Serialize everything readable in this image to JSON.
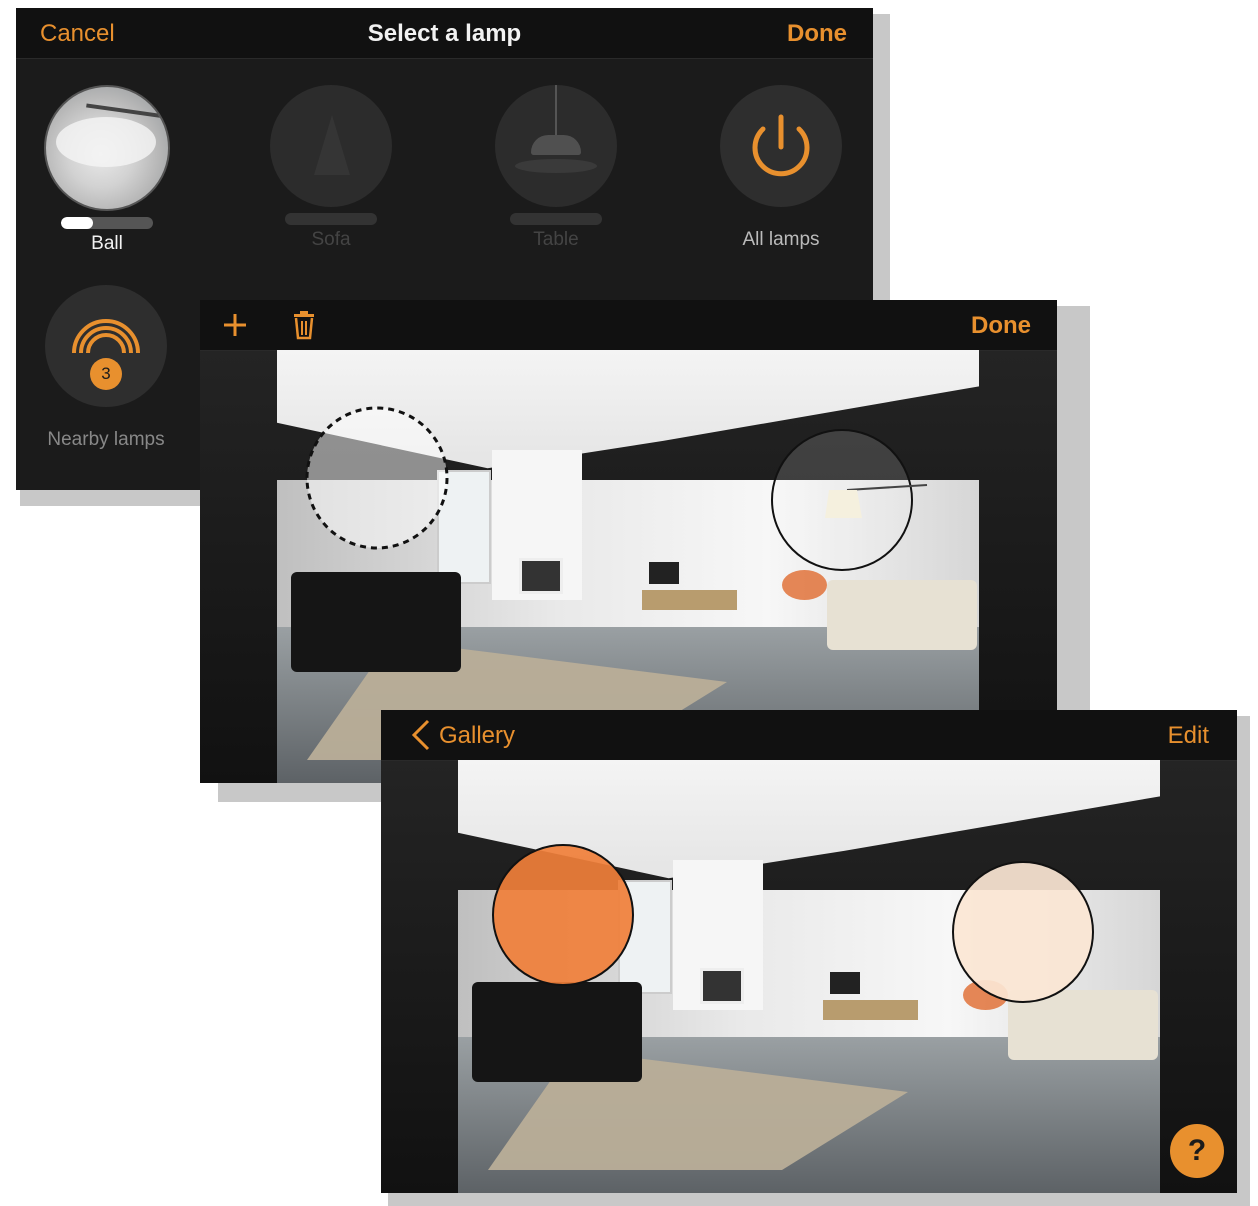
{
  "select_screen": {
    "cancel_label": "Cancel",
    "title": "Select a lamp",
    "done_label": "Done",
    "lamps": [
      {
        "label": "Ball",
        "brightness": 0.35,
        "enabled": true
      },
      {
        "label": "Sofa",
        "enabled": false
      },
      {
        "label": "Table",
        "enabled": false
      },
      {
        "label": "All lamps",
        "icon": "power-icon",
        "enabled": true
      }
    ],
    "nearby": {
      "label": "Nearby lamps",
      "count": "3",
      "icon": "signal-arcs-icon"
    }
  },
  "edit_screen": {
    "add_icon": "plus-icon",
    "delete_icon": "trash-icon",
    "done_label": "Done"
  },
  "gallery_screen": {
    "back_label": "Gallery",
    "edit_label": "Edit",
    "help_label": "?"
  },
  "colors": {
    "accent": "#e8902e",
    "bar_bg": "#111111",
    "panel_bg": "#1b1b1b",
    "lamp_orange": "#f07f3a",
    "lamp_warm_white": "#fbe6d4"
  }
}
